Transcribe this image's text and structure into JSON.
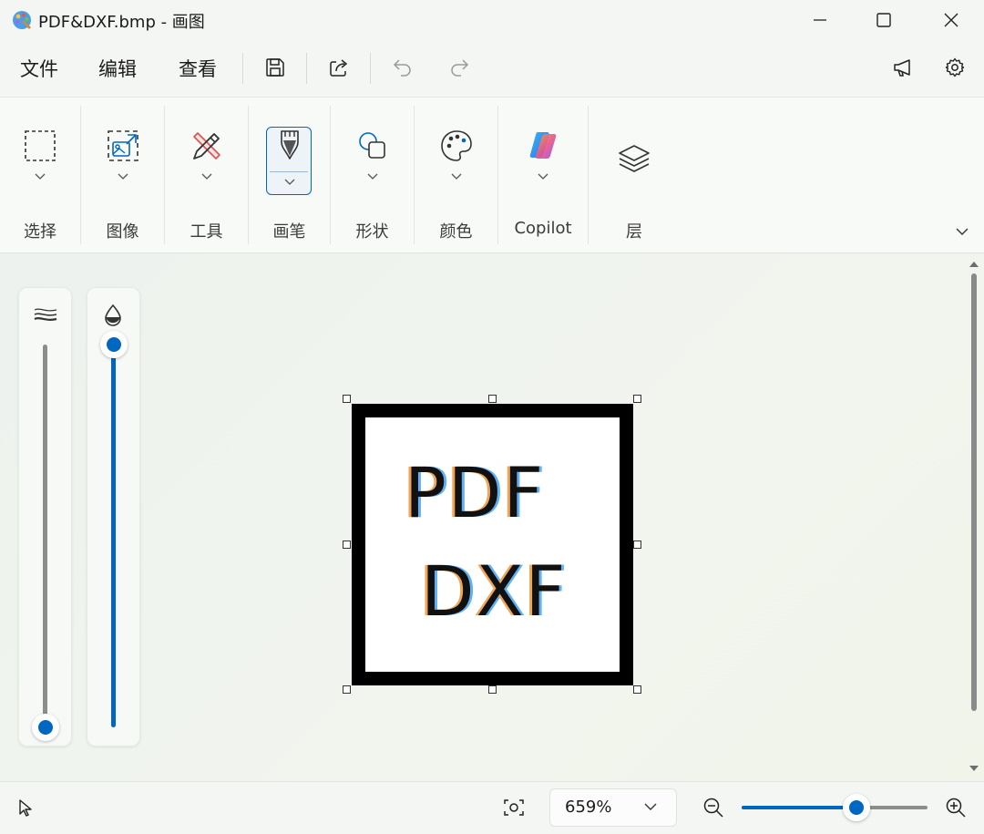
{
  "window": {
    "title": "PDF&DXF.bmp - 画图"
  },
  "menu": {
    "file": "文件",
    "edit": "编辑",
    "view": "查看"
  },
  "ribbon": {
    "groups": [
      {
        "label": "选择",
        "icon": "selection-icon"
      },
      {
        "label": "图像",
        "icon": "image-icon"
      },
      {
        "label": "工具",
        "icon": "tools-icon"
      },
      {
        "label": "画笔",
        "icon": "brush-icon",
        "selected": true
      },
      {
        "label": "形状",
        "icon": "shapes-icon"
      },
      {
        "label": "颜色",
        "icon": "palette-icon"
      },
      {
        "label": "Copilot",
        "icon": "copilot-icon"
      },
      {
        "label": "层",
        "icon": "layers-icon"
      }
    ]
  },
  "sliders": {
    "size_level": 0.0,
    "opacity_level": 1.0
  },
  "canvas": {
    "line1": "PDF",
    "line2": "DXF"
  },
  "status": {
    "zoom": "659%",
    "zoom_slider_level": 0.62
  },
  "colors": {
    "accent": "#0067c0",
    "frame": "#000000"
  }
}
